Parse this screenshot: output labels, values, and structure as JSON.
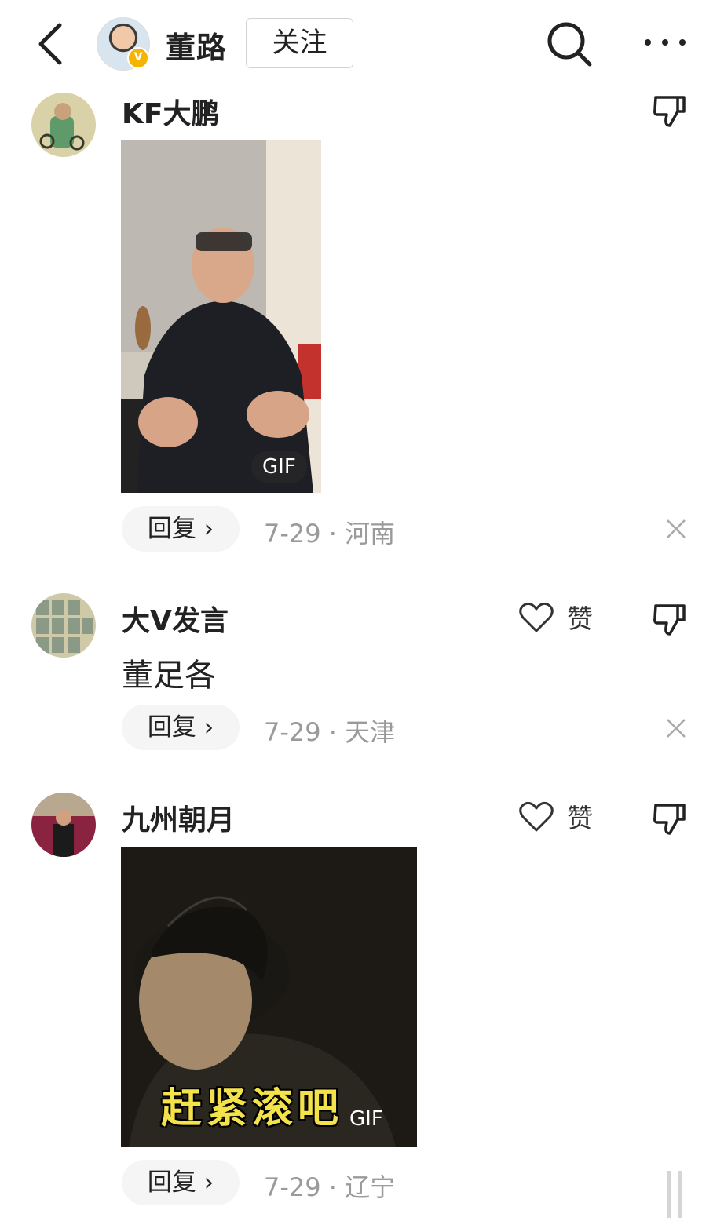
{
  "header": {
    "author_name": "董路",
    "follow_label": "关注",
    "verified_mark": "V"
  },
  "comments": [
    {
      "username": "KF大鹏",
      "media": {
        "badge": "GIF"
      },
      "reply_label": "回复 ›",
      "meta": "7-29 · 河南"
    },
    {
      "username": "大V发言",
      "like_label": "赞",
      "text": "董足各",
      "reply_label": "回复 ›",
      "meta": "7-29 · 天津"
    },
    {
      "username": "九州朝月",
      "like_label": "赞",
      "media": {
        "badge": "GIF",
        "caption": "赶紧滚吧"
      },
      "reply_label": "回复 ›",
      "meta": "7-29 · 辽宁"
    }
  ],
  "colors": {
    "meta_gray": "#9a9a9a",
    "reply_bg": "#f5f5f5",
    "verify_gold": "#f5b400",
    "caption_yellow": "#f3e24a"
  }
}
